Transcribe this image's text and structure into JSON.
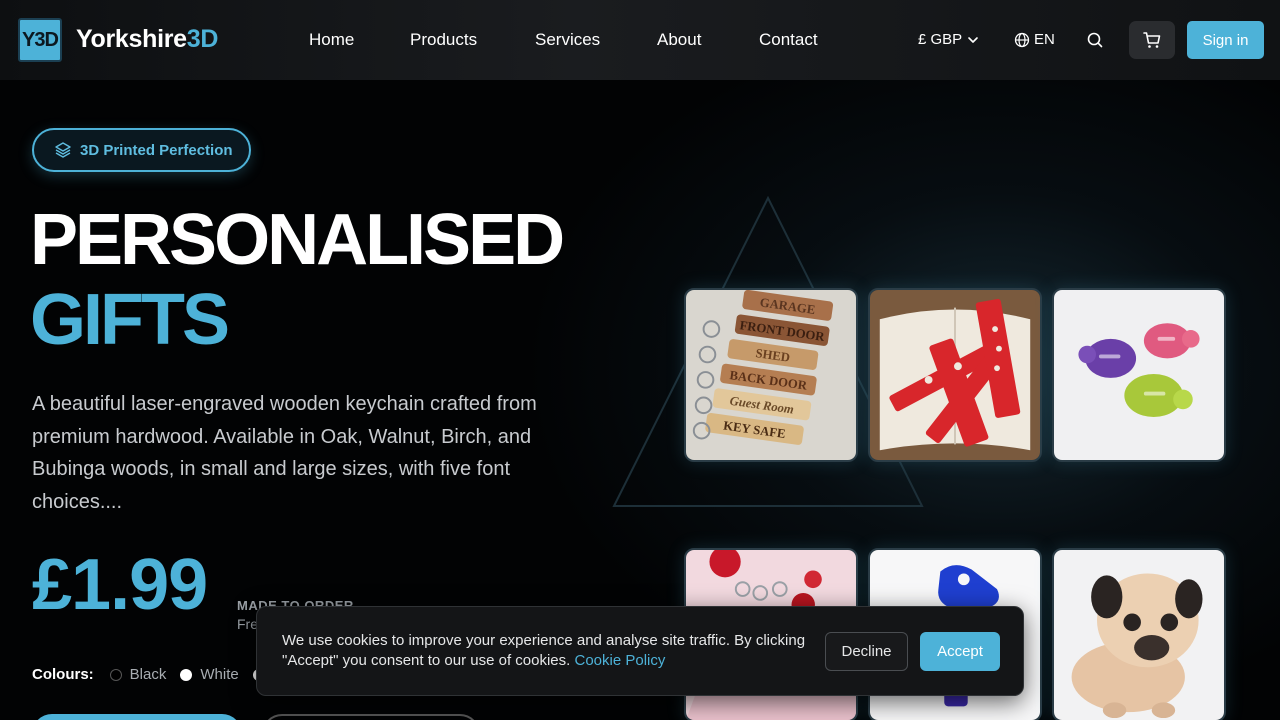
{
  "header": {
    "logo_text": "Y3D",
    "brand_part1": "Yorkshire",
    "brand_part2": "3D",
    "nav": [
      "Home",
      "Products",
      "Services",
      "About",
      "Contact"
    ],
    "currency": "£ GBP",
    "language": "EN",
    "signin_label": "Sign in"
  },
  "hero": {
    "badge": "3D Printed Perfection",
    "title_line1": "PERSONALISED",
    "title_line2": "GIFTS",
    "description": "A beautiful laser-engraved wooden keychain crafted from premium hardwood. Available in Oak, Walnut, Birch, and Bubinga woods, in small and large sizes, with five font choices....",
    "price": "£1.99",
    "made_label": "MADE TO ORDER",
    "free_label": "Fre",
    "colours_label": "Colours:",
    "colours": [
      {
        "name": "Black",
        "hex": "#000000"
      },
      {
        "name": "White",
        "hex": "#ffffff"
      }
    ]
  },
  "products": {
    "tile_images": [
      "wooden-keychains-image",
      "red-bookmarks-image",
      "turtles-image",
      "rose-keychains-image",
      "blue-print-image",
      "pug-figure-image"
    ],
    "keychain_labels": [
      "GARAGE",
      "FRONT DOOR",
      "SHED",
      "BACK DOOR",
      "Guest Room",
      "KEY SAFE"
    ]
  },
  "cookie": {
    "text": "We use cookies to improve your experience and analyse site traffic. By clicking \"Accept\" you consent to our use of cookies.",
    "link": "Cookie Policy",
    "decline": "Decline",
    "accept": "Accept"
  },
  "colors": {
    "accent": "#4db2d8",
    "background": "#020304"
  }
}
